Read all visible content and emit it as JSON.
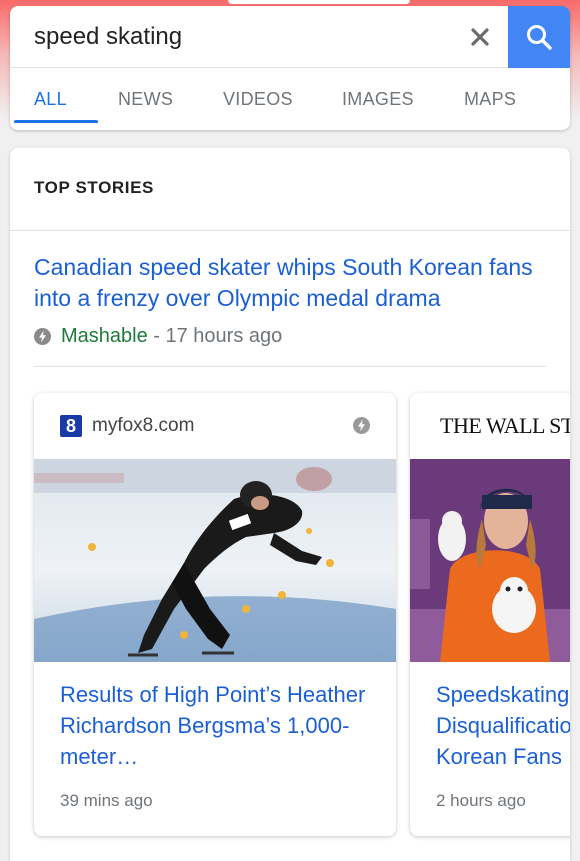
{
  "search": {
    "query": "speed skating"
  },
  "tabs": [
    {
      "label": "ALL",
      "active": true
    },
    {
      "label": "NEWS",
      "active": false
    },
    {
      "label": "VIDEOS",
      "active": false
    },
    {
      "label": "IMAGES",
      "active": false
    },
    {
      "label": "MAPS",
      "active": false
    }
  ],
  "colors": {
    "accent": "#4285f4",
    "link": "#1a5fd6",
    "source_green": "#1e7a3a"
  },
  "icons": {
    "clear": "close-icon",
    "search": "search-icon",
    "amp": "amp-bolt-icon"
  },
  "top_stories": {
    "title": "TOP STORIES",
    "lead": {
      "headline": "Canadian speed skater whips South Korean fans into a frenzy over Olympic medal drama",
      "source": "Mashable",
      "time": " - 17 hours ago"
    },
    "cards": [
      {
        "publisher": "myfox8.com",
        "publisher_logo_letter": "8",
        "title": "Results of High Point’s Heather Richardson Bergsma’s 1,000-meter…",
        "time": "39 mins ago"
      },
      {
        "publisher": "THE WALL STREE",
        "title_lines": [
          "Speedskating",
          "Disqualificatio",
          "Korean Fans"
        ],
        "time": "2 hours ago"
      }
    ]
  }
}
